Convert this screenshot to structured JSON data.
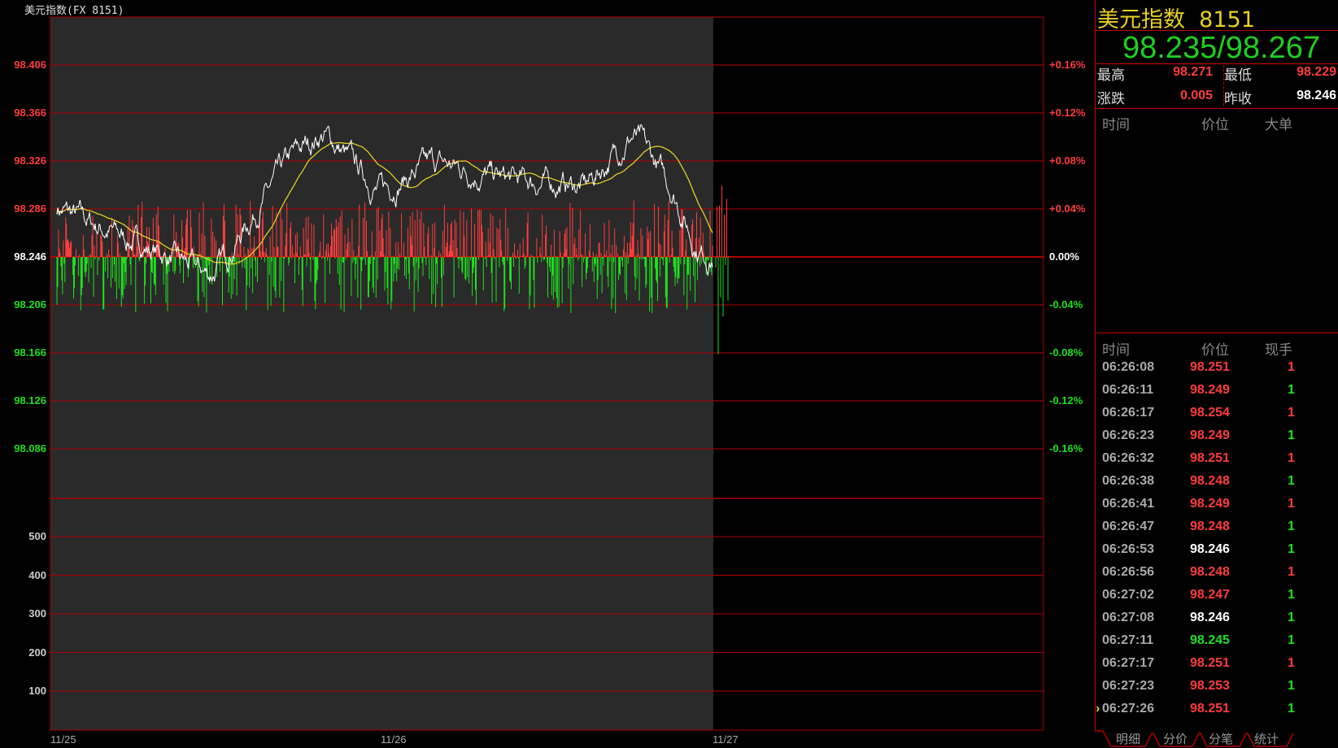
{
  "window_title": "美元指数(FX 8151)",
  "chart": {
    "price_ticks": [
      "98.406",
      "98.366",
      "98.326",
      "98.286",
      "98.246",
      "98.206",
      "98.166",
      "98.126",
      "98.086"
    ],
    "pct_ticks": [
      "+0.16%",
      "+0.12%",
      "+0.08%",
      "+0.04%",
      "0.00%",
      "-0.04%",
      "-0.08%",
      "-0.12%",
      "-0.16%"
    ],
    "volume_ticks": [
      "500",
      "400",
      "300",
      "200",
      "100"
    ],
    "date_labels": [
      "11/25",
      "11/26",
      "11/27"
    ],
    "prev_close": 98.246,
    "colors": {
      "up": "#ff3c3c",
      "down": "#1ee01e",
      "price_line": "#ffffff",
      "avg_line": "#e0d020",
      "grid": "#b00000",
      "shade": "#2a2a2a"
    }
  },
  "panel": {
    "name": "美元指数",
    "code": "8151",
    "quote": "98.235/98.267",
    "high_label": "最高",
    "high": "98.271",
    "low_label": "最低",
    "low": "98.229",
    "change_label": "涨跌",
    "change": "0.005",
    "prev_label": "昨收",
    "prev": "98.246",
    "big_header": [
      "时间",
      "价位",
      "大单"
    ],
    "ticks_header": [
      "时间",
      "价位",
      "现手"
    ],
    "ticks": [
      {
        "time": "06:26:08",
        "price": "98.251",
        "vol": "1",
        "pc": "up",
        "vc": "up"
      },
      {
        "time": "06:26:11",
        "price": "98.249",
        "vol": "1",
        "pc": "up",
        "vc": "down"
      },
      {
        "time": "06:26:17",
        "price": "98.254",
        "vol": "1",
        "pc": "up",
        "vc": "up"
      },
      {
        "time": "06:26:23",
        "price": "98.249",
        "vol": "1",
        "pc": "up",
        "vc": "down"
      },
      {
        "time": "06:26:32",
        "price": "98.251",
        "vol": "1",
        "pc": "up",
        "vc": "up"
      },
      {
        "time": "06:26:38",
        "price": "98.248",
        "vol": "1",
        "pc": "up",
        "vc": "down"
      },
      {
        "time": "06:26:41",
        "price": "98.249",
        "vol": "1",
        "pc": "up",
        "vc": "up"
      },
      {
        "time": "06:26:47",
        "price": "98.248",
        "vol": "1",
        "pc": "up",
        "vc": "down"
      },
      {
        "time": "06:26:53",
        "price": "98.246",
        "vol": "1",
        "pc": "flat",
        "vc": "down"
      },
      {
        "time": "06:26:56",
        "price": "98.248",
        "vol": "1",
        "pc": "up",
        "vc": "up"
      },
      {
        "time": "06:27:02",
        "price": "98.247",
        "vol": "1",
        "pc": "up",
        "vc": "down"
      },
      {
        "time": "06:27:08",
        "price": "98.246",
        "vol": "1",
        "pc": "flat",
        "vc": "down"
      },
      {
        "time": "06:27:11",
        "price": "98.245",
        "vol": "1",
        "pc": "down",
        "vc": "down"
      },
      {
        "time": "06:27:17",
        "price": "98.251",
        "vol": "1",
        "pc": "up",
        "vc": "up"
      },
      {
        "time": "06:27:23",
        "price": "98.253",
        "vol": "1",
        "pc": "up",
        "vc": "down"
      },
      {
        "time": "06:27:26",
        "price": "98.251",
        "vol": "1",
        "pc": "up",
        "vc": "down"
      }
    ],
    "tabs": [
      "明细",
      "分价",
      "分笔",
      "统计"
    ]
  }
}
